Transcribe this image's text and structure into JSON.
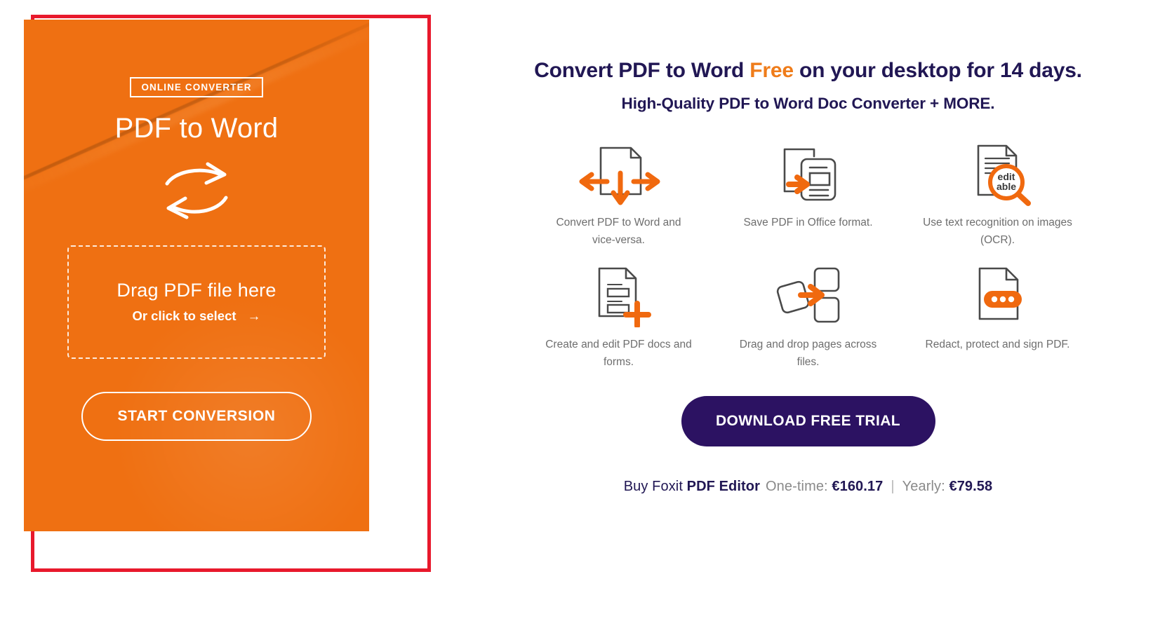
{
  "converter": {
    "badge": "ONLINE CONVERTER",
    "title": "PDF to Word",
    "swap_icon": "convert-swap-arrows-icon",
    "dropzone": {
      "main": "Drag PDF file here",
      "sub": "Or click to select",
      "arrow": "→"
    },
    "start_button": "START CONVERSION",
    "accent_color": "#ef7012",
    "highlight_color": "#e8192c"
  },
  "promo": {
    "headline": {
      "before": "Convert PDF to Word ",
      "emphasis": "Free",
      "after": " on your desktop for 14 days."
    },
    "subheadline": "High-Quality PDF to Word Doc Converter + MORE.",
    "features": [
      {
        "icon": "pdf-to-word-arrows-icon",
        "caption": "Convert PDF to Word and vice-versa."
      },
      {
        "icon": "save-office-format-icon",
        "caption": "Save PDF in Office format."
      },
      {
        "icon": "ocr-editable-magnifier-icon",
        "caption": "Use text recognition on images (OCR).",
        "icon_label": "edit able"
      },
      {
        "icon": "create-edit-pdf-plus-icon",
        "caption": "Create and edit PDF docs and forms."
      },
      {
        "icon": "drag-drop-pages-icon",
        "caption": "Drag and drop pages across files."
      },
      {
        "icon": "redact-protect-sign-icon",
        "caption": "Redact, protect and sign PDF."
      }
    ],
    "download_button": "DOWNLOAD FREE TRIAL",
    "pricing": {
      "buy_text": "Buy Foxit ",
      "product": "PDF Editor",
      "onetime_label": "One-time:",
      "onetime_price": "€160.17",
      "separator": "|",
      "yearly_label": "Yearly:",
      "yearly_price": "€79.58"
    },
    "headline_color": "#211754",
    "accent_color": "#ef7c1a",
    "button_color": "#2c1262"
  }
}
